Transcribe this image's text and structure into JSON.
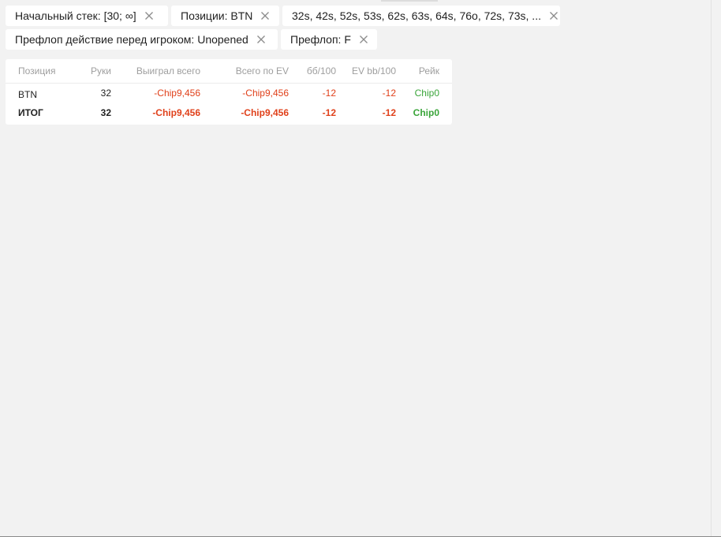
{
  "filters": [
    {
      "label": "Начальный стек: [30; ∞]"
    },
    {
      "label": "Позиции: BTN"
    },
    {
      "label": "32s, 42s, 52s, 53s, 62s, 63s, 64s, 76o, 72s, 73s, ..."
    },
    {
      "label": "Префлоп действие перед игроком: Unopened"
    },
    {
      "label": "Префлоп: F"
    }
  ],
  "table": {
    "headers": {
      "position": "Позиция",
      "hands": "Руки",
      "won_total": "Выиграл всего",
      "ev_total": "Всего по EV",
      "bb100": "бб/100",
      "ev_bb100": "EV bb/100",
      "rake": "Рейк"
    },
    "rows": [
      {
        "position": "BTN",
        "hands": "32",
        "won_total": "-Chip9,456",
        "ev_total": "-Chip9,456",
        "bb100": "-12",
        "ev_bb100": "-12",
        "rake": "Chip0"
      }
    ],
    "total": {
      "position": "ИТОГ",
      "hands": "32",
      "won_total": "-Chip9,456",
      "ev_total": "-Chip9,456",
      "bb100": "-12",
      "ev_bb100": "-12",
      "rake": "Chip0"
    }
  },
  "colors": {
    "negative": "#e0411b",
    "positive": "#3aa53a",
    "header_text": "#9e9e9e",
    "background": "#f2f2f2"
  }
}
